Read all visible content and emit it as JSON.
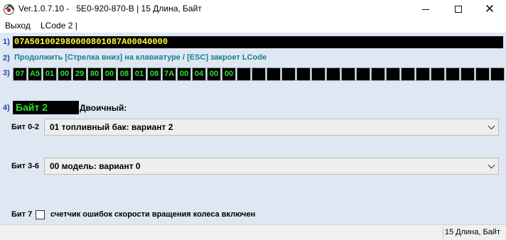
{
  "window": {
    "title": "Ver.1.0.7.10 -   5E0-920-870-B | 15 Длина, Байт",
    "controls": {
      "minimize": "minimize",
      "maximize": "maximize",
      "close": "close"
    }
  },
  "menu": [
    {
      "label": "Выход"
    },
    {
      "label": "LCode 2 |"
    }
  ],
  "rows": {
    "r1": "1)",
    "r2": "2)",
    "r3": "3)",
    "r4": "4)"
  },
  "lcode": {
    "value": "07A5010029800080108 7A00040000"
  },
  "hint": "Продолжить [Стрелка вниз] на клавиатуре / [ESC] закроет LCode",
  "bytes": [
    "07",
    "A5",
    "01",
    "00",
    "29",
    "80",
    "00",
    "08",
    "01",
    "08",
    "7A",
    "00",
    "04",
    "00",
    "00",
    "",
    "",
    "",
    "",
    "",
    "",
    "",
    "",
    "",
    "",
    "",
    "",
    "",
    "",
    "",
    "",
    "",
    ""
  ],
  "byte_section": {
    "label": "Байт 2",
    "binary_label": "Двоичный:"
  },
  "bits": [
    {
      "label": "Бит 0-2",
      "value": "01 топливный бак: вариант 2"
    },
    {
      "label": "Бит 3-6",
      "value": "00 модель: вариант 0"
    }
  ],
  "bit7": {
    "label": "Бит 7",
    "checked": false,
    "text": "счетчик ошибок скорости вращения колеса включен"
  },
  "status": "15 Длина, Байт",
  "colors": {
    "panel_bg": "#dfe7f2",
    "hex_yellow": "#ffff3c",
    "byte_green": "#2fe02f",
    "hint_teal": "#1b7f8f",
    "row_num_blue": "#1f4aa8"
  }
}
